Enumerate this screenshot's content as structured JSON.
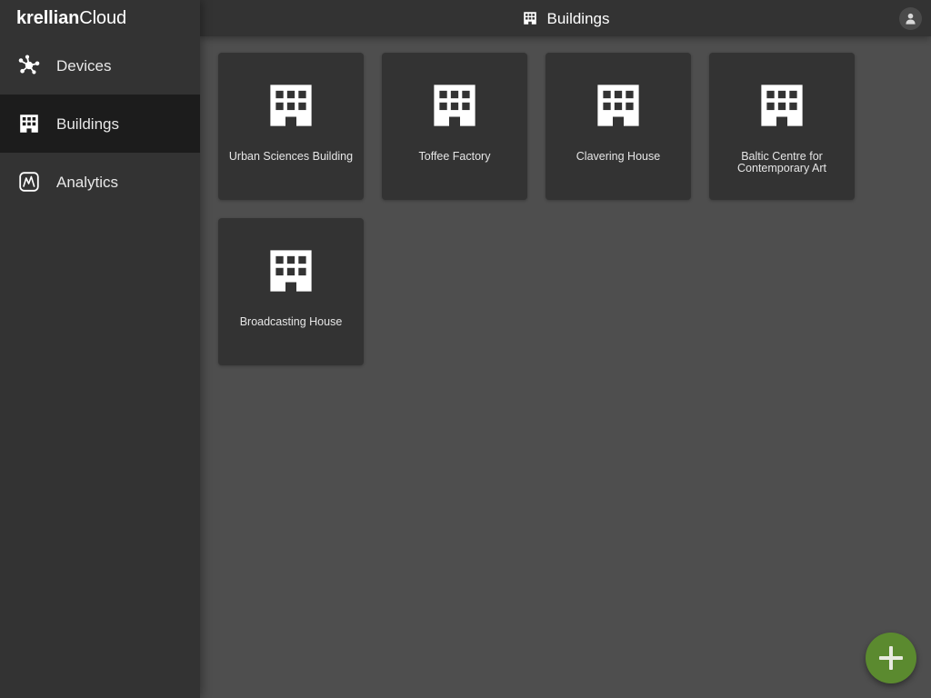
{
  "brand": {
    "strong": "krellian",
    "light": "Cloud"
  },
  "sidebar": {
    "items": [
      {
        "label": "Devices",
        "icon": "devices-hub-icon",
        "active": false
      },
      {
        "label": "Buildings",
        "icon": "building-icon",
        "active": true
      },
      {
        "label": "Analytics",
        "icon": "analytics-chart-icon",
        "active": false
      }
    ]
  },
  "header": {
    "icon": "building-icon",
    "title": "Buildings",
    "user_icon": "user-avatar-icon"
  },
  "main": {
    "cards": [
      {
        "label": "Urban Sciences Building",
        "icon": "building-icon"
      },
      {
        "label": "Toffee Factory",
        "icon": "building-icon"
      },
      {
        "label": "Clavering House",
        "icon": "building-icon"
      },
      {
        "label": "Baltic Centre for Contemporary Art",
        "icon": "building-icon"
      },
      {
        "label": "Broadcasting House",
        "icon": "building-icon"
      }
    ]
  },
  "fab": {
    "label": "+",
    "name": "add-building-button",
    "color": "#5b8a2f"
  },
  "colors": {
    "sidebar_bg": "#333333",
    "sidebar_active_bg": "#1c1c1c",
    "header_bg": "#333333",
    "main_bg": "#4e4e4e",
    "card_bg": "#333333",
    "accent_green": "#5b8a2f",
    "text_primary": "#ffffff",
    "text_secondary": "#e6e6e6"
  }
}
